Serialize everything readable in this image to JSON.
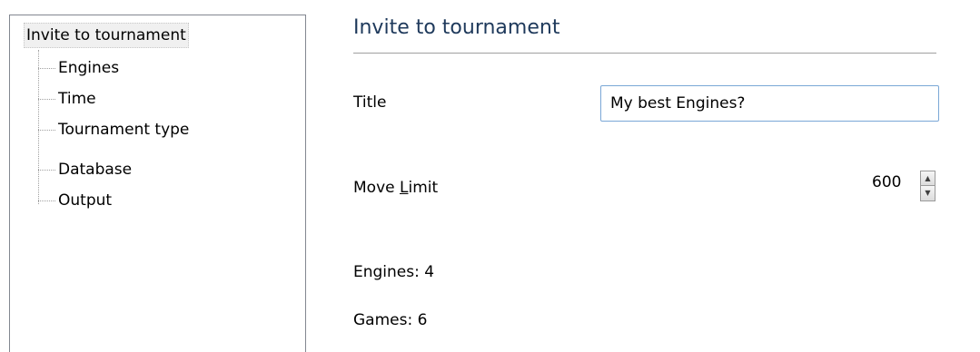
{
  "tree": {
    "root": "Invite to tournament",
    "items": [
      {
        "label": "Engines"
      },
      {
        "label": "Time"
      },
      {
        "label": "Tournament type"
      },
      {
        "label": "Database"
      },
      {
        "label": "Output"
      }
    ]
  },
  "panel": {
    "heading": "Invite to tournament",
    "title_label": "Title",
    "title_value": "My best Engines?",
    "move_limit_label_before": "Move ",
    "move_limit_label_mnemonic": "L",
    "move_limit_label_after": "imit",
    "move_limit_value": "600",
    "engines_text": "Engines: 4",
    "games_text": "Games: 6"
  },
  "icons": {
    "spin_up": "spin-up-icon",
    "spin_down": "spin-down-icon"
  }
}
